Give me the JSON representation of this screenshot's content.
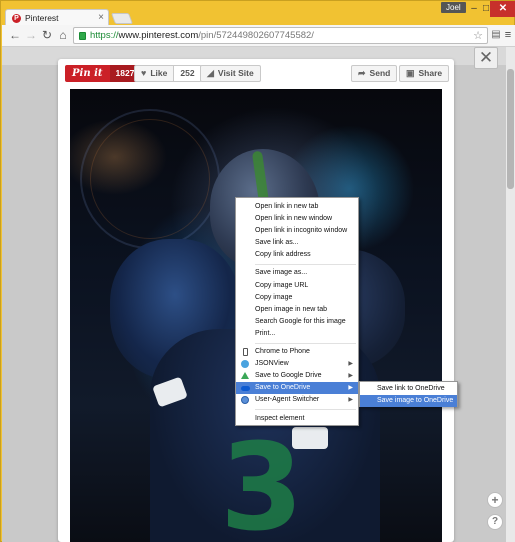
{
  "browser": {
    "tab": {
      "title": "Pinterest",
      "favicon": "pinterest-logo-icon"
    },
    "user": "Joel",
    "window_buttons": {
      "minimize": "–",
      "maximize": "□",
      "close": "✕"
    },
    "url": {
      "scheme": "https://",
      "host": "www.pinterest.com",
      "path": "/pin/572449802607745582/"
    }
  },
  "pin": {
    "pin_it_label": "Pin it",
    "pin_count": "1827",
    "like_label": "Like",
    "like_count": "252",
    "visit_label": "Visit Site",
    "send_label": "Send",
    "share_label": "Share",
    "close_symbol": "✕",
    "jersey_number": "3"
  },
  "context_menu": {
    "items": [
      {
        "label": "Open link in new tab"
      },
      {
        "label": "Open link in new window"
      },
      {
        "label": "Open link in incognito window"
      },
      {
        "label": "Save link as..."
      },
      {
        "label": "Copy link address"
      },
      {
        "label": "Save image as..."
      },
      {
        "label": "Copy image URL"
      },
      {
        "label": "Copy image"
      },
      {
        "label": "Open image in new tab"
      },
      {
        "label": "Search Google for this image"
      },
      {
        "label": "Print..."
      },
      {
        "label": "Chrome to Phone",
        "icon": "phone-icon"
      },
      {
        "label": "JSONView",
        "icon": "jsonview-icon",
        "submenu": true
      },
      {
        "label": "Save to Google Drive",
        "icon": "google-drive-icon",
        "submenu": true
      },
      {
        "label": "Save to OneDrive",
        "icon": "onedrive-icon",
        "submenu": true,
        "highlighted": true
      },
      {
        "label": "User-Agent Switcher",
        "icon": "user-agent-switcher-icon",
        "submenu": true
      },
      {
        "label": "Inspect element"
      }
    ]
  },
  "onedrive_submenu": {
    "items": [
      {
        "label": "Save link to OneDrive"
      },
      {
        "label": "Save image to OneDrive",
        "highlighted": true
      }
    ]
  },
  "side_buttons": {
    "add": "+",
    "help": "?"
  },
  "colors": {
    "window_frame": "#f1c232",
    "pinterest_red": "#cb2027",
    "menu_highlight": "#4a7fd6",
    "https_green": "#1a8b34"
  }
}
